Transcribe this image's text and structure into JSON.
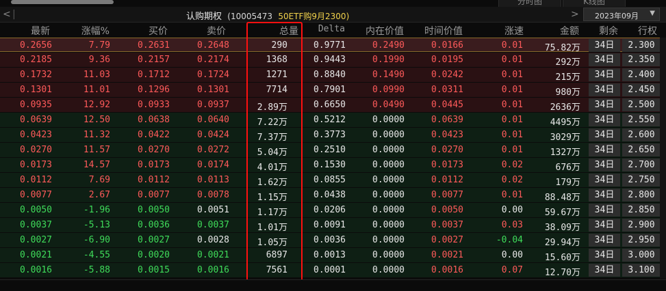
{
  "top_tabs": [
    "分时图",
    "K线图"
  ],
  "header": {
    "title": "认购期权",
    "code": "(10005473",
    "name": "50ETF购9月2300)",
    "month": "2023年09月"
  },
  "columns": [
    "最新",
    "涨幅%",
    "买价",
    "卖价",
    "总量",
    "Delta",
    "内在价值",
    "时间价值",
    "涨速",
    "金额",
    "剩余",
    "行权"
  ],
  "rows": [
    {
      "last": "0.2656",
      "chg": "7.79",
      "bid": "0.2631",
      "ask": "0.2648",
      "vol": "290",
      "delta": "0.9771",
      "intr": "0.2490",
      "tv": "0.0166",
      "spd": "0.01",
      "amt": "75.82万",
      "days": "34日",
      "strike": "2.300"
    },
    {
      "last": "0.2185",
      "chg": "9.36",
      "bid": "0.2157",
      "ask": "0.2174",
      "vol": "1368",
      "delta": "0.9443",
      "intr": "0.1990",
      "tv": "0.0195",
      "spd": "0.01",
      "amt": "292万",
      "days": "34日",
      "strike": "2.350"
    },
    {
      "last": "0.1732",
      "chg": "11.03",
      "bid": "0.1712",
      "ask": "0.1724",
      "vol": "1271",
      "delta": "0.8840",
      "intr": "0.1490",
      "tv": "0.0242",
      "spd": "0.01",
      "amt": "215万",
      "days": "34日",
      "strike": "2.400"
    },
    {
      "last": "0.1301",
      "chg": "11.01",
      "bid": "0.1296",
      "ask": "0.1301",
      "vol": "7714",
      "delta": "0.7901",
      "intr": "0.0990",
      "tv": "0.0311",
      "spd": "0.01",
      "amt": "980万",
      "days": "34日",
      "strike": "2.450"
    },
    {
      "last": "0.0935",
      "chg": "12.92",
      "bid": "0.0933",
      "ask": "0.0937",
      "vol": "2.89万",
      "delta": "0.6650",
      "intr": "0.0490",
      "tv": "0.0445",
      "spd": "0.01",
      "amt": "2636万",
      "days": "34日",
      "strike": "2.500"
    },
    {
      "last": "0.0639",
      "chg": "12.50",
      "bid": "0.0638",
      "ask": "0.0640",
      "vol": "7.22万",
      "delta": "0.5212",
      "intr": "0.0000",
      "tv": "0.0639",
      "spd": "0.01",
      "amt": "4495万",
      "days": "34日",
      "strike": "2.550"
    },
    {
      "last": "0.0423",
      "chg": "11.32",
      "bid": "0.0422",
      "ask": "0.0424",
      "vol": "7.37万",
      "delta": "0.3773",
      "intr": "0.0000",
      "tv": "0.0423",
      "spd": "0.01",
      "amt": "3029万",
      "days": "34日",
      "strike": "2.600"
    },
    {
      "last": "0.0270",
      "chg": "11.57",
      "bid": "0.0270",
      "ask": "0.0272",
      "vol": "5.04万",
      "delta": "0.2510",
      "intr": "0.0000",
      "tv": "0.0270",
      "spd": "0.01",
      "amt": "1327万",
      "days": "34日",
      "strike": "2.650"
    },
    {
      "last": "0.0173",
      "chg": "14.57",
      "bid": "0.0173",
      "ask": "0.0174",
      "vol": "4.01万",
      "delta": "0.1530",
      "intr": "0.0000",
      "tv": "0.0173",
      "spd": "0.02",
      "amt": "676万",
      "days": "34日",
      "strike": "2.700"
    },
    {
      "last": "0.0112",
      "chg": "7.69",
      "bid": "0.0112",
      "ask": "0.0113",
      "vol": "1.62万",
      "delta": "0.0855",
      "intr": "0.0000",
      "tv": "0.0112",
      "spd": "0.02",
      "amt": "179万",
      "days": "34日",
      "strike": "2.750"
    },
    {
      "last": "0.0077",
      "chg": "2.67",
      "bid": "0.0077",
      "ask": "0.0078",
      "vol": "1.15万",
      "delta": "0.0438",
      "intr": "0.0000",
      "tv": "0.0077",
      "spd": "0.01",
      "amt": "88.48万",
      "days": "34日",
      "strike": "2.800"
    },
    {
      "last": "0.0050",
      "chg": "-1.96",
      "bid": "0.0050",
      "ask": "0.0051",
      "vol": "1.17万",
      "delta": "0.0206",
      "intr": "0.0000",
      "tv": "0.0050",
      "spd": "0.00",
      "amt": "59.67万",
      "days": "34日",
      "strike": "2.850"
    },
    {
      "last": "0.0037",
      "chg": "-5.13",
      "bid": "0.0036",
      "ask": "0.0037",
      "vol": "1.01万",
      "delta": "0.0091",
      "intr": "0.0000",
      "tv": "0.0037",
      "spd": "0.03",
      "amt": "38.09万",
      "days": "34日",
      "strike": "2.900"
    },
    {
      "last": "0.0027",
      "chg": "-6.90",
      "bid": "0.0027",
      "ask": "0.0028",
      "vol": "1.05万",
      "delta": "0.0036",
      "intr": "0.0000",
      "tv": "0.0027",
      "spd": "-0.04",
      "amt": "29.94万",
      "days": "34日",
      "strike": "2.950"
    },
    {
      "last": "0.0021",
      "chg": "-4.55",
      "bid": "0.0020",
      "ask": "0.0021",
      "vol": "6897",
      "delta": "0.0013",
      "intr": "0.0000",
      "tv": "0.0021",
      "spd": "0.00",
      "amt": "15.60万",
      "days": "34日",
      "strike": "3.000"
    },
    {
      "last": "0.0016",
      "chg": "-5.88",
      "bid": "0.0015",
      "ask": "0.0016",
      "vol": "7561",
      "delta": "0.0001",
      "intr": "0.0000",
      "tv": "0.0016",
      "spd": "0.07",
      "amt": "12.70万",
      "days": "34日",
      "strike": "3.100"
    }
  ],
  "colors": {
    "up": "#ff5a5a",
    "down": "#3fdc5a",
    "highlight": "#ff1010"
  }
}
